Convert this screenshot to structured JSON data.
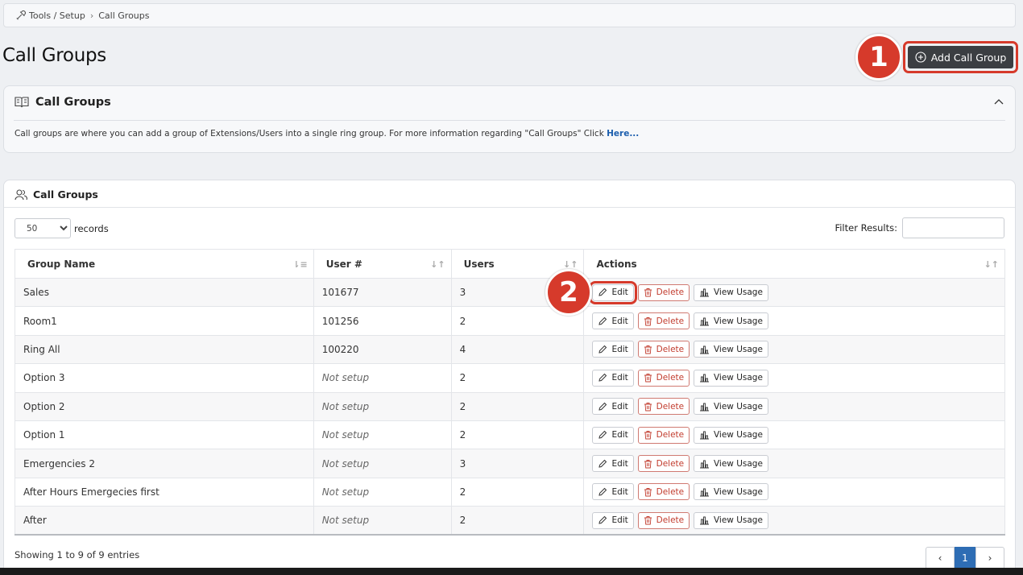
{
  "breadcrumb": {
    "section": "Tools / Setup",
    "current": "Call Groups"
  },
  "page_title": "Call Groups",
  "add_button": {
    "label": "Add Call Group"
  },
  "markers": {
    "one": "1",
    "two": "2"
  },
  "info_card": {
    "title": "Call Groups",
    "description": "Call groups are where you can add a group of Extensions/Users into a single ring group. For more information regarding \"Call Groups\" Click ",
    "link": "Here..."
  },
  "table_card": {
    "title": "Call Groups",
    "records_value": "50",
    "records_label": "records",
    "filter_label": "Filter Results:",
    "columns": [
      "Group Name",
      "User #",
      "Users",
      "Actions"
    ],
    "actions": {
      "edit": "Edit",
      "delete": "Delete",
      "usage": "View Usage"
    },
    "rows": [
      {
        "name": "Sales",
        "user_no": "101677",
        "users": "3"
      },
      {
        "name": "Room1",
        "user_no": "101256",
        "users": "2"
      },
      {
        "name": "Ring All",
        "user_no": "100220",
        "users": "4"
      },
      {
        "name": "Option 3",
        "user_no": "Not setup",
        "users": "2"
      },
      {
        "name": "Option 2",
        "user_no": "Not setup",
        "users": "2"
      },
      {
        "name": "Option 1",
        "user_no": "Not setup",
        "users": "2"
      },
      {
        "name": "Emergencies 2",
        "user_no": "Not setup",
        "users": "3"
      },
      {
        "name": "After Hours Emergecies first",
        "user_no": "Not setup",
        "users": "2"
      },
      {
        "name": "After",
        "user_no": "Not setup",
        "users": "2"
      }
    ],
    "footer": "Showing 1 to 9 of 9 entries",
    "pager": {
      "prev": "‹",
      "page": "1",
      "next": "›"
    }
  },
  "colors": {
    "highlight": "#d63a2b",
    "dark_button": "#3b3e42",
    "link": "#1d5fae",
    "pager_active": "#2e6db4"
  }
}
